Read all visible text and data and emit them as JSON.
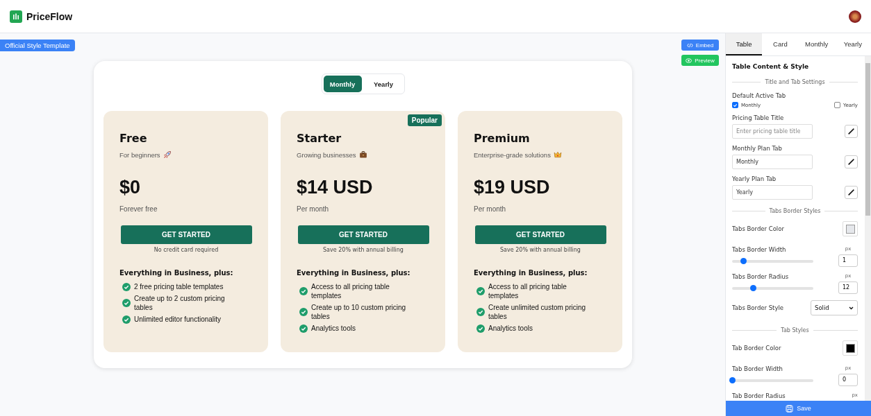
{
  "header": {
    "brand": "PriceFlow"
  },
  "template_badge": "Official Style Template",
  "actions": [
    {
      "label": "Embed",
      "kind": "embed"
    },
    {
      "label": "Preview",
      "kind": "preview"
    }
  ],
  "pricing": {
    "tabs": [
      {
        "label": "Monthly",
        "selected": true
      },
      {
        "label": "Yearly",
        "selected": false
      }
    ],
    "plans": [
      {
        "name": "Free",
        "subtitle": "For beginners",
        "price": "$0",
        "period": "Forever free",
        "button": "GET STARTED",
        "note": "No credit card required",
        "features_title": "Everything in Business, plus:",
        "features": [
          "2 free pricing table templates",
          "Create up to 2 custom pricing tables",
          "Unlimited editor functionality"
        ]
      },
      {
        "name": "Starter",
        "badge": "Popular",
        "subtitle": "Growing businesses",
        "price": "$14 USD",
        "period": "Per month",
        "button": "GET STARTED",
        "note": "Save 20% with annual billing",
        "features_title": "Everything in Business, plus:",
        "features": [
          "Access to all pricing table templates",
          "Create up to 10 custom pricing tables",
          "Analytics tools"
        ]
      },
      {
        "name": "Premium",
        "subtitle": "Enterprise-grade solutions",
        "price": "$19 USD",
        "period": "Per month",
        "button": "GET STARTED",
        "note": "Save 20% with annual billing",
        "features_title": "Everything in Business, plus:",
        "features": [
          "Access to all pricing table templates",
          "Create unlimited custom pricing tables",
          "Analytics tools"
        ]
      }
    ]
  },
  "panel": {
    "tabs": [
      {
        "label": "Table",
        "selected": true
      },
      {
        "label": "Card",
        "selected": false
      },
      {
        "label": "Monthly",
        "selected": false
      },
      {
        "label": "Yearly",
        "selected": false
      }
    ],
    "title": "Table Content & Style",
    "rows": [
      {
        "kind": "divider",
        "label": "Title and Tab Settings"
      },
      {
        "kind": "checks",
        "label": "Default Active Tab",
        "options": [
          {
            "label": "Monthly",
            "checked": true
          },
          {
            "label": "Yearly",
            "checked": false
          }
        ]
      },
      {
        "kind": "text",
        "label": "Pricing Table Title",
        "placeholder": "Enter pricing table title"
      },
      {
        "kind": "text",
        "label": "Monthly Plan Tab",
        "value": "Monthly"
      },
      {
        "kind": "text",
        "label": "Yearly Plan Tab",
        "value": "Yearly"
      },
      {
        "kind": "divider",
        "label": "Tabs Border Styles"
      },
      {
        "kind": "color",
        "label": "Tabs Border Color",
        "color": "#e5e7eb"
      },
      {
        "kind": "slider",
        "label": "Tabs Border Width",
        "unit": "px",
        "value": "1",
        "level": 0.14
      },
      {
        "kind": "slider",
        "label": "Tabs Border Radius",
        "unit": "px",
        "value": "12",
        "level": 0.26
      },
      {
        "kind": "select",
        "label": "Tabs Border Style",
        "value": "Solid"
      },
      {
        "kind": "divider",
        "label": "Tab Styles"
      },
      {
        "kind": "color",
        "label": "Tab Border Color",
        "color": "#000000"
      },
      {
        "kind": "slider",
        "label": "Tab Border Width",
        "unit": "px",
        "value": "0",
        "level": 0
      },
      {
        "kind": "slider",
        "label": "Tab Border Radius",
        "unit": "px"
      }
    ],
    "save": "Save"
  }
}
